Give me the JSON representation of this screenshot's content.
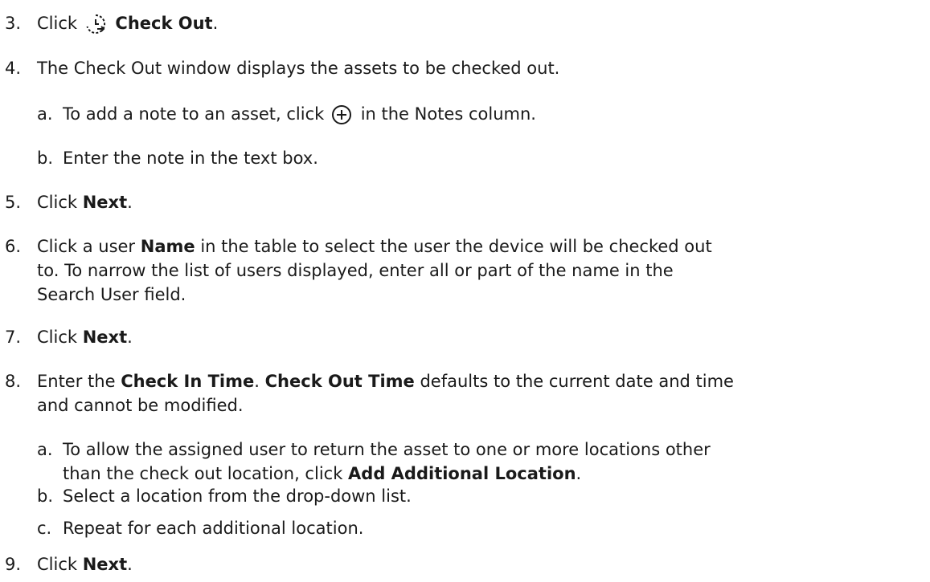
{
  "steps": [
    {
      "num": "3.",
      "pre": "Click",
      "icon": "check-out-clock-icon",
      "bold": "Check Out",
      "post": "."
    },
    {
      "num": "4.",
      "text": "The Check Out window displays the assets to be checked out."
    },
    {
      "num": "a.",
      "pre": "To add a note to an asset, click",
      "icon": "add-circle-icon",
      "post": "in the Notes column."
    },
    {
      "num": "b.",
      "text": "Enter the note in the text box."
    },
    {
      "num": "5.",
      "pre": "Click",
      "bold": "Next",
      "post": "."
    },
    {
      "num": "6.",
      "pre": "Click a user",
      "bold": "Name",
      "line1_post": "in the table to select the user the device will be checked out",
      "line2": "to. To narrow the list of users displayed, enter all or part of the name in the",
      "line3": "Search User field."
    },
    {
      "num": "7.",
      "pre": "Click",
      "bold": "Next",
      "post": "."
    },
    {
      "num": "8.",
      "pre": "Enter the",
      "bold1": "Check In Time",
      "mid": ".",
      "bold2": "Check Out Time",
      "line1_post": "defaults to the current date and time",
      "line2": "and cannot be modified."
    },
    {
      "num": "a.",
      "line1": "To allow the assigned user to return the asset to one or more locations other",
      "pre": "than the check out location, click",
      "bold": "Add Additional Location",
      "post": "."
    },
    {
      "num": "b.",
      "text": "Select a location from the drop-down list."
    },
    {
      "num": "c.",
      "text": "Repeat for each additional location."
    },
    {
      "num": "9.",
      "pre": "Click",
      "bold": "Next",
      "post": "."
    }
  ]
}
